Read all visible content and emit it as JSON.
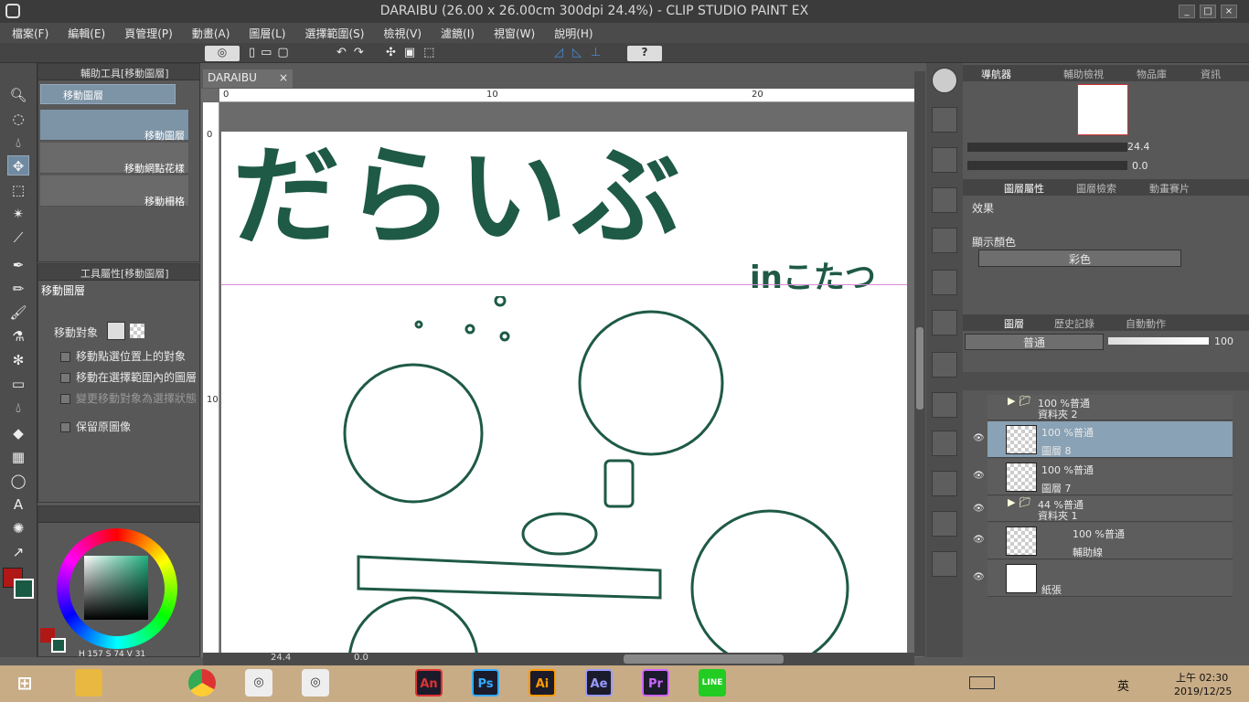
{
  "window": {
    "title": "DARAIBU (26.00 x 26.00cm 300dpi 24.4%) - CLIP STUDIO PAINT EX",
    "buttons": [
      "_",
      "□",
      "×"
    ]
  },
  "menu": [
    "檔案(F)",
    "編輯(E)",
    "頁管理(P)",
    "動畫(A)",
    "圖層(L)",
    "選擇範圍(S)",
    "檢視(V)",
    "濾鏡(I)",
    "視窗(W)",
    "說明(H)"
  ],
  "sub_tool_panel": {
    "title": "輔助工具[移動圖層]",
    "group_label": "移動圖層",
    "items": [
      "移動圖層",
      "移動網點花樣",
      "移動柵格"
    ]
  },
  "tool_property": {
    "title": "工具屬性[移動圖層]",
    "name": "移動圖層",
    "target_label": "移動對象",
    "options": [
      "移動點選位置上的對象",
      "移動在選擇範圍內的圖層",
      "變更移動對象為選擇狀態",
      "保留原圖像"
    ]
  },
  "color": {
    "main": "#b01818",
    "sub": "#1a5a45",
    "h": "157",
    "s": "74",
    "v": "31",
    "h_label": "H",
    "s_label": "S",
    "v_label": "V"
  },
  "document": {
    "tab": "DARAIBU",
    "ruler_h": [
      "0",
      "10",
      "20"
    ],
    "ruler_v": [
      "0",
      "10"
    ],
    "zoom": "24.4",
    "rotation": "0.0",
    "artwork_title": "だらいぶ",
    "artwork_subtitle": "inこたつ"
  },
  "navigator": {
    "tabs": [
      "導航器",
      "輔助檢視",
      "物品庫",
      "資訊"
    ],
    "zoom": "24.4",
    "rotation": "0.0"
  },
  "layer_property": {
    "tabs": [
      "圖層屬性",
      "圖層檢索",
      "動畫賽片"
    ],
    "effect_label": "效果",
    "display_color_label": "顯示顏色",
    "display_color_value": "彩色"
  },
  "layers_panel": {
    "tabs": [
      "圖層",
      "歷史記錄",
      "自動動作"
    ],
    "blend_mode": "普通",
    "opacity": "100",
    "layers": [
      {
        "mode": "100 %普通",
        "name": "資料夾 2",
        "type": "folder"
      },
      {
        "mode": "100 %普通",
        "name": "圖層 8",
        "type": "raster",
        "selected": true
      },
      {
        "mode": "100 %普通",
        "name": "圖層 7",
        "type": "raster"
      },
      {
        "mode": "44 %普通",
        "name": "資料夾 1",
        "type": "folder"
      },
      {
        "mode": "100 %普通",
        "name": "輔助線",
        "type": "raster"
      },
      {
        "mode": "",
        "name": "紙張",
        "type": "paper"
      }
    ]
  },
  "taskbar": {
    "apps": [
      "An",
      "Ps",
      "Ai",
      "Ae",
      "Pr",
      "LINE"
    ],
    "ime": "英",
    "time": "上午 02:30",
    "date": "2019/12/25"
  }
}
